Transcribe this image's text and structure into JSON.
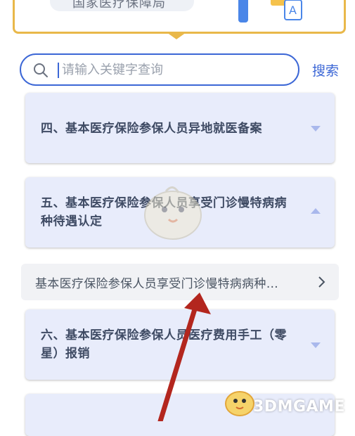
{
  "banner": {
    "title": "国家医疗保障局"
  },
  "search": {
    "placeholder": "请输入关键字查询",
    "button_label": "搜索"
  },
  "cards": [
    {
      "title": "四、基本医疗保险参保人员异地就医备案",
      "expanded": false
    },
    {
      "title": "五、基本医疗保险参保人员享受门诊慢特病病种待遇认定",
      "expanded": true
    },
    {
      "title": "六、基本医疗保险参保人员医疗费用手工（零星）报销",
      "expanded": false
    }
  ],
  "sub_item": {
    "label": "基本医疗保险参保人员享受门诊慢特病病种…"
  },
  "watermark": {
    "text": "3DMGAME"
  },
  "colors": {
    "accent": "#3c67d6",
    "card_bg": "#e8ecfb",
    "banner_border": "#e9b84a",
    "arrow": "#b3261e"
  }
}
